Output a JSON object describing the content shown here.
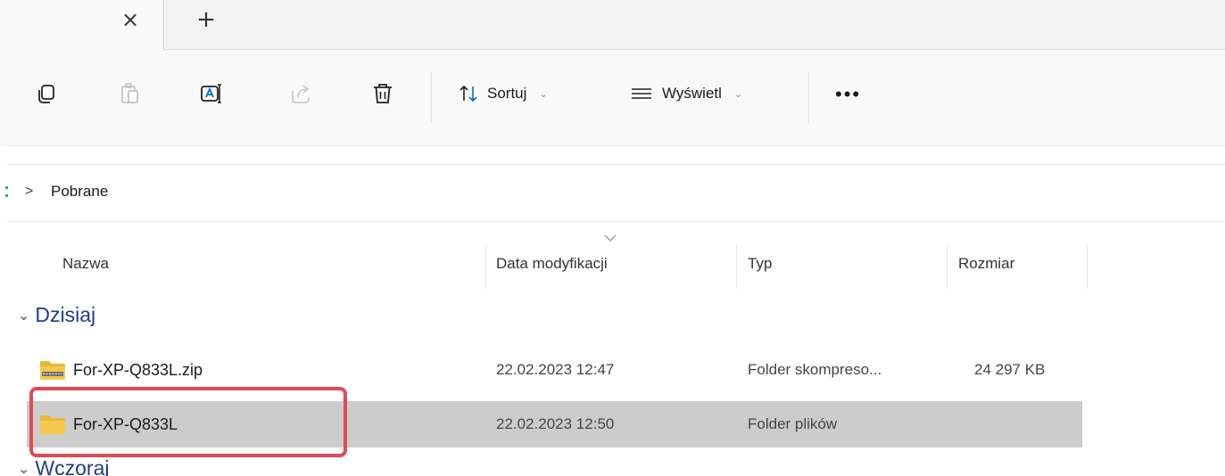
{
  "tabs": {
    "close_glyph": "×",
    "new_glyph": "+"
  },
  "toolbar": {
    "sort_label": "Sortuj",
    "view_label": "Wyświetl",
    "more_glyph": "•••",
    "chevron_glyph": "⌄"
  },
  "address": {
    "separator": ">",
    "current": "Pobrane"
  },
  "columns": {
    "name": "Nazwa",
    "date": "Data modyfikacji",
    "type": "Typ",
    "size": "Rozmiar"
  },
  "groups": {
    "today": "Dzisiaj",
    "yesterday": "Wczoraj"
  },
  "files": [
    {
      "name": "For-XP-Q833L.zip",
      "date": "22.02.2023 12:47",
      "type": "Folder skompreso...",
      "size": "24 297 KB",
      "icon": "zip-folder-icon"
    },
    {
      "name": "For-XP-Q833L",
      "date": "22.02.2023 12:50",
      "type": "Folder plików",
      "size": "",
      "icon": "folder-icon"
    }
  ],
  "colors": {
    "accent_group": "#1f3d8a",
    "selection": "#cccccc",
    "highlight": "#e14a55",
    "folder": "#f7c948"
  }
}
